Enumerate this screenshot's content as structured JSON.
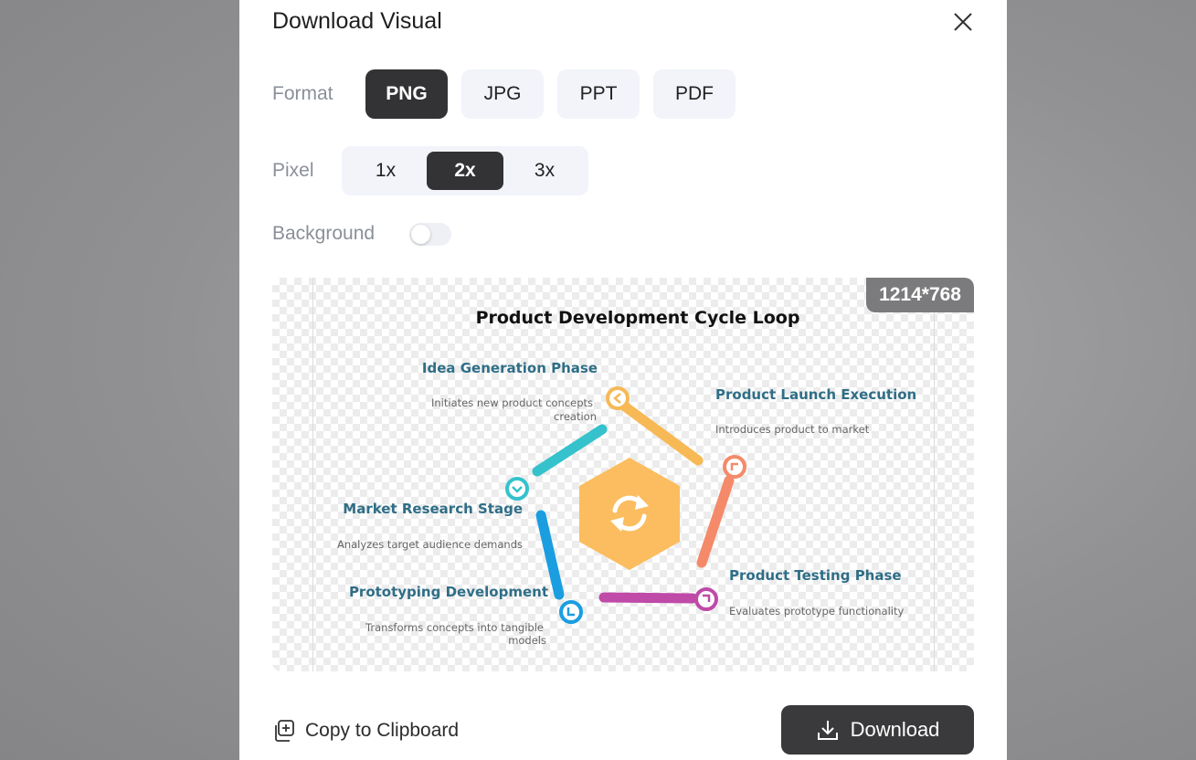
{
  "dialog": {
    "title": "Download Visual"
  },
  "format": {
    "label": "Format",
    "options": [
      "PNG",
      "JPG",
      "PPT",
      "PDF"
    ],
    "selected": "PNG"
  },
  "pixel": {
    "label": "Pixel",
    "options": [
      "1x",
      "2x",
      "3x"
    ],
    "selected": "2x"
  },
  "background": {
    "label": "Background",
    "enabled": false
  },
  "preview": {
    "dimensions": "1214*768",
    "diagram": {
      "title": "Product Development Cycle Loop",
      "stages": [
        {
          "name": "Idea Generation Phase",
          "desc_line1": "Initiates new product concepts",
          "desc_line2": "creation",
          "color": "#f7b955"
        },
        {
          "name": "Product Launch Execution",
          "desc_line1": "Introduces product to market",
          "desc_line2": "",
          "color": "#f48a6a"
        },
        {
          "name": "Product Testing Phase",
          "desc_line1": "Evaluates prototype functionality",
          "desc_line2": "",
          "color": "#bf4aa8"
        },
        {
          "name": "Prototyping Development",
          "desc_line1": "Transforms concepts into tangible",
          "desc_line2": "models",
          "color": "#1a9ee0"
        },
        {
          "name": "Market Research Stage",
          "desc_line1": "Analyzes target audience demands",
          "desc_line2": "",
          "color": "#35c2cc"
        }
      ],
      "center_color": "#fbbd5f",
      "label_color": "#2f6e86"
    }
  },
  "footer": {
    "copy_label": "Copy to Clipboard",
    "download_label": "Download"
  },
  "colors": {
    "active_button": "#333335",
    "inactive_button": "#f2f4fa",
    "download_button": "#3a3a3c"
  }
}
